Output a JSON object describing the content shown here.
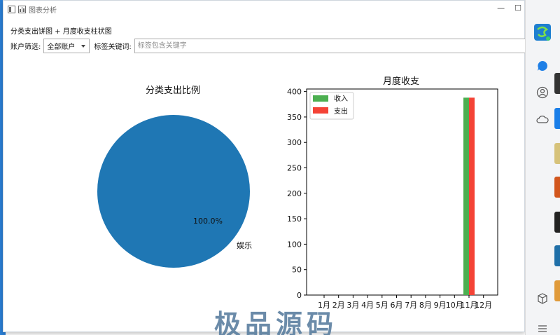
{
  "window": {
    "title": "图表分析",
    "min_glyph": "—",
    "max_glyph": "☐"
  },
  "header": {
    "label": "分类支出饼图 + 月度收支柱状图"
  },
  "filters": {
    "account_label": "账户筛选:",
    "account_value": "全部账户",
    "tag_label": "标签关键词:",
    "tag_placeholder": "标签包含关键字"
  },
  "colors": {
    "pie": "#1f77b4",
    "income": "#4caf50",
    "expense": "#f44336"
  },
  "chart_data": [
    {
      "type": "pie",
      "title": "分类支出比例",
      "slices": [
        {
          "label": "娱乐",
          "value": 100.0,
          "pct_label": "100.0%"
        }
      ]
    },
    {
      "type": "bar",
      "title": "月度收支",
      "categories": [
        "1月",
        "2月",
        "3月",
        "4月",
        "5月",
        "6月",
        "7月",
        "8月",
        "9月",
        "10月",
        "11月",
        "12月"
      ],
      "series": [
        {
          "name": "收入",
          "values": [
            0,
            0,
            0,
            0,
            0,
            0,
            0,
            0,
            0,
            0,
            388,
            0
          ]
        },
        {
          "name": "支出",
          "values": [
            0,
            0,
            0,
            0,
            0,
            0,
            0,
            0,
            0,
            0,
            388,
            0
          ]
        }
      ],
      "ylim": [
        0,
        405
      ],
      "yticks": [
        0,
        50,
        100,
        150,
        200,
        250,
        300,
        350,
        400
      ],
      "legend": "top-left",
      "grid": false
    }
  ],
  "side_panel": {
    "icons": [
      "app-logo-icon",
      "chat-bubble-icon",
      "person-icon",
      "cloud-icon",
      "cube-icon",
      "menu-icon"
    ]
  },
  "watermark": "极品源码"
}
